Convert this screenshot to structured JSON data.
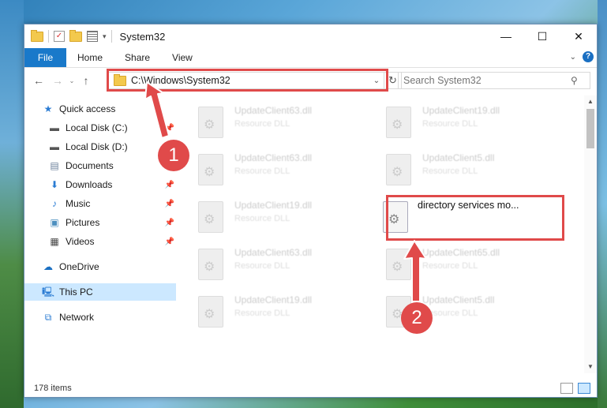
{
  "window": {
    "title": "System32",
    "controls": {
      "minimize": "—",
      "maximize": "☐",
      "close": "✕"
    }
  },
  "ribbon": {
    "file": "File",
    "tabs": [
      "Home",
      "Share",
      "View"
    ]
  },
  "nav": {
    "back": "←",
    "forward": "→",
    "recent": "⌄",
    "up": "↑",
    "address": "C:\\Windows\\System32",
    "refresh": "↻",
    "search_placeholder": "Search System32",
    "search_icon": "⚲"
  },
  "sidebar": {
    "items": [
      {
        "label": "Quick access",
        "icon": "star-icon"
      },
      {
        "label": "Local Disk (C:)",
        "icon": "drive-icon",
        "pinned": true
      },
      {
        "label": "Local Disk (D:)",
        "icon": "drive-icon"
      },
      {
        "label": "Documents",
        "icon": "documents-icon"
      },
      {
        "label": "Downloads",
        "icon": "download-icon",
        "pinned": true
      },
      {
        "label": "Music",
        "icon": "music-icon",
        "pinned": true
      },
      {
        "label": "Pictures",
        "icon": "pictures-icon",
        "pinned": true
      },
      {
        "label": "Videos",
        "icon": "videos-icon",
        "pinned": true
      },
      {
        "label": "OneDrive",
        "icon": "cloud-icon"
      },
      {
        "label": "This PC",
        "icon": "computer-icon",
        "selected": true
      },
      {
        "label": "Network",
        "icon": "network-icon"
      }
    ]
  },
  "files": [
    {
      "name": "UpdateClient63.dll",
      "type": "Resource DLL"
    },
    {
      "name": "UpdateClient19.dll",
      "type": "Resource DLL"
    },
    {
      "name": "UpdateClient63.dll",
      "type": "Resource DLL"
    },
    {
      "name": "UpdateClient5.dll",
      "type": "Resource DLL"
    },
    {
      "name": "UpdateClient19.dll",
      "type": "Resource DLL"
    },
    {
      "name": "directory services mo...",
      "type": ""
    },
    {
      "name": "UpdateClient63.dll",
      "type": "Resource DLL"
    },
    {
      "name": "UpdateClient65.dll",
      "type": "Resource DLL"
    },
    {
      "name": "UpdateClient19.dll",
      "type": "Resource DLL"
    },
    {
      "name": "UpdateClient5.dll",
      "type": "Resource DLL"
    }
  ],
  "status": {
    "item_count": "178 items"
  },
  "annotations": {
    "step1": "1",
    "step2": "2",
    "accent": "#e04a4a"
  }
}
